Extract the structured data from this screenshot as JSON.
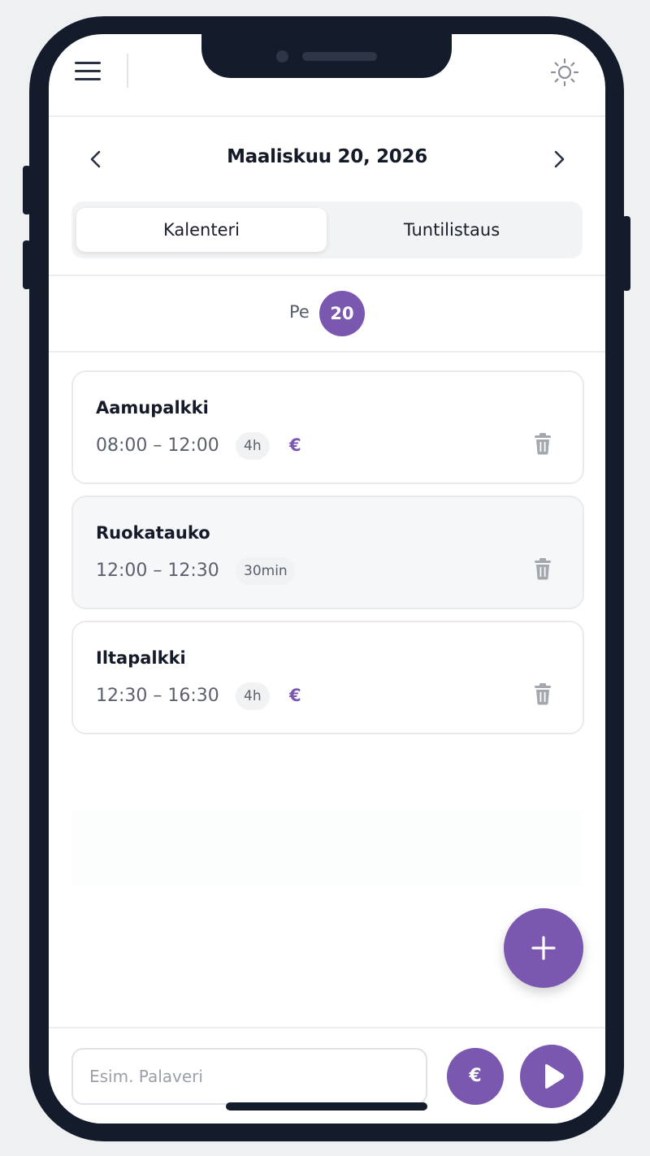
{
  "header": {
    "menu_icon": "hamburger-menu-icon",
    "theme_icon": "sun-icon"
  },
  "date_nav": {
    "title": "Maaliskuu 20, 2026",
    "prev_icon": "chevron-left-icon",
    "next_icon": "chevron-right-icon"
  },
  "tabs": [
    {
      "label": "Kalenteri",
      "active": true
    },
    {
      "label": "Tuntilistaus",
      "active": false
    }
  ],
  "day": {
    "weekday": "Pe",
    "number": "20"
  },
  "entries": [
    {
      "title": "Aamupalkki",
      "time": "08:00 – 12:00",
      "duration": "4h",
      "billable": "€"
    },
    {
      "title": "Ruokatauko",
      "time": "12:00 – 12:30",
      "duration": "30min",
      "billable": ""
    },
    {
      "title": "Iltapalkki",
      "time": "12:30 – 16:30",
      "duration": "4h",
      "billable": "€"
    }
  ],
  "bottom": {
    "input_placeholder": "Esim. Palaveri",
    "euro_label": "€"
  },
  "colors": {
    "accent": "#7b58b0",
    "text": "#141a28",
    "muted": "#5a616c",
    "frame": "#141c2b"
  }
}
